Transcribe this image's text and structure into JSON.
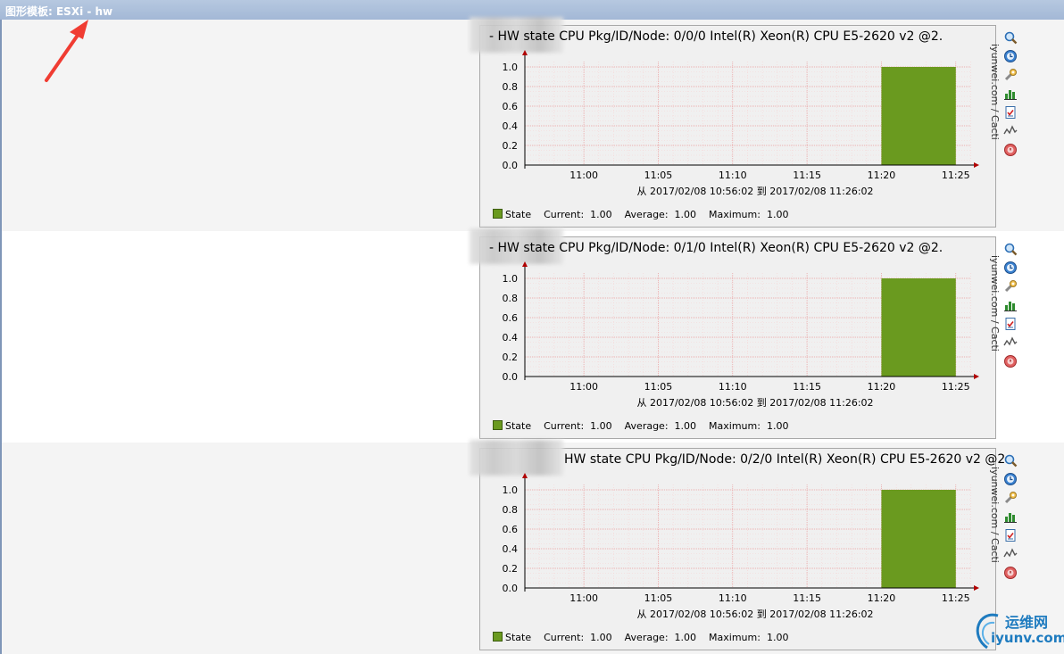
{
  "header": {
    "title": "图形模板: ESXi - hw"
  },
  "graphs": [
    {
      "title": "- HW state CPU Pkg/ID/Node: 0/0/0 Intel(R) Xeon(R) CPU E5-2620 v2 @2.",
      "side_label": "iyunwei.com / Cacti",
      "range": "从 2017/02/08 10:56:02 到 2017/02/08 11:26:02",
      "legend": {
        "name": "State",
        "current_label": "Current:",
        "current": "1.00",
        "average_label": "Average:",
        "average": "1.00",
        "maximum_label": "Maximum:",
        "maximum": "1.00"
      },
      "chart_data": {
        "type": "area",
        "x": [
          "11:00",
          "11:05",
          "11:10",
          "11:15",
          "11:20",
          "11:25"
        ],
        "y_ticks": [
          "0.0",
          "0.2",
          "0.4",
          "0.6",
          "0.8",
          "1.0"
        ],
        "ylim": [
          0,
          1.0
        ],
        "series": [
          {
            "name": "State",
            "color": "#6a9a1f",
            "start": "11:20",
            "end": "11:25",
            "value": 1.0
          }
        ]
      }
    },
    {
      "title": "- HW state CPU Pkg/ID/Node: 0/1/0 Intel(R) Xeon(R) CPU E5-2620 v2 @2.",
      "side_label": "iyunwei.com / Cacti",
      "range": "从 2017/02/08 10:56:02 到 2017/02/08 11:26:02",
      "legend": {
        "name": "State",
        "current_label": "Current:",
        "current": "1.00",
        "average_label": "Average:",
        "average": "1.00",
        "maximum_label": "Maximum:",
        "maximum": "1.00"
      },
      "chart_data": {
        "type": "area",
        "x": [
          "11:00",
          "11:05",
          "11:10",
          "11:15",
          "11:20",
          "11:25"
        ],
        "y_ticks": [
          "0.0",
          "0.2",
          "0.4",
          "0.6",
          "0.8",
          "1.0"
        ],
        "ylim": [
          0,
          1.0
        ],
        "series": [
          {
            "name": "State",
            "color": "#6a9a1f",
            "start": "11:20",
            "end": "11:25",
            "value": 1.0
          }
        ]
      }
    },
    {
      "title": "HW state CPU Pkg/ID/Node: 0/2/0 Intel(R) Xeon(R) CPU E5-2620 v2 @2.",
      "side_label": "iyunwei.com / Cacti",
      "range": "从 2017/02/08 10:56:02 到 2017/02/08 11:26:02",
      "legend": {
        "name": "State",
        "current_label": "Current:",
        "current": "1.00",
        "average_label": "Average:",
        "average": "1.00",
        "maximum_label": "Maximum:",
        "maximum": "1.00"
      },
      "chart_data": {
        "type": "area",
        "x": [
          "11:00",
          "11:05",
          "11:10",
          "11:15",
          "11:20",
          "11:25"
        ],
        "y_ticks": [
          "0.0",
          "0.2",
          "0.4",
          "0.6",
          "0.8",
          "1.0"
        ],
        "ylim": [
          0,
          1.0
        ],
        "series": [
          {
            "name": "State",
            "color": "#6a9a1f",
            "start": "11:20",
            "end": "11:25",
            "value": 1.0
          }
        ]
      }
    }
  ],
  "icons": [
    "zoom-icon",
    "time-shift-icon",
    "properties-icon",
    "stats-icon",
    "csv-export-icon",
    "realtime-icon",
    "delete-icon"
  ],
  "logo": {
    "cn": "运维网",
    "en": "iyunv.com"
  },
  "colors": {
    "accent": "#1e7bbf",
    "area": "#6a9a1f",
    "grid": "#f2b8b8",
    "arrow": "#f03c32"
  }
}
